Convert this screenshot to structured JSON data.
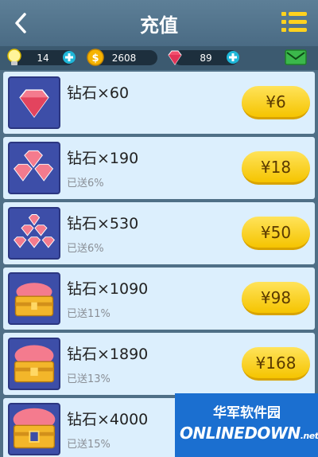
{
  "header": {
    "title": "充值",
    "back_icon": "back-chevron-icon",
    "menu_icon": "menu-list-icon"
  },
  "resources": {
    "lightbulb": {
      "value": "14",
      "icon": "lightbulb-icon"
    },
    "coins": {
      "value": "2608",
      "icon": "coin-icon"
    },
    "diamonds": {
      "value": "89",
      "icon": "diamond-icon"
    },
    "mail_icon": "mail-icon"
  },
  "items": [
    {
      "name": "钻石×60",
      "bonus": "",
      "price": "¥6"
    },
    {
      "name": "钻石×190",
      "bonus": "已送6%",
      "price": "¥18"
    },
    {
      "name": "钻石×530",
      "bonus": "已送6%",
      "price": "¥50"
    },
    {
      "name": "钻石×1090",
      "bonus": "已送11%",
      "price": "¥98"
    },
    {
      "name": "钻石×1890",
      "bonus": "已送13%",
      "price": "¥168"
    },
    {
      "name": "钻石×4000",
      "bonus": "已送15%",
      "price": ""
    }
  ],
  "watermark": {
    "cn": "华军软件园",
    "en": "ONLINEDOWN",
    "suffix": ".net"
  },
  "colors": {
    "accent": "#f5c400",
    "row_bg": "#dceffd",
    "header_bg": "#4f6f86"
  }
}
